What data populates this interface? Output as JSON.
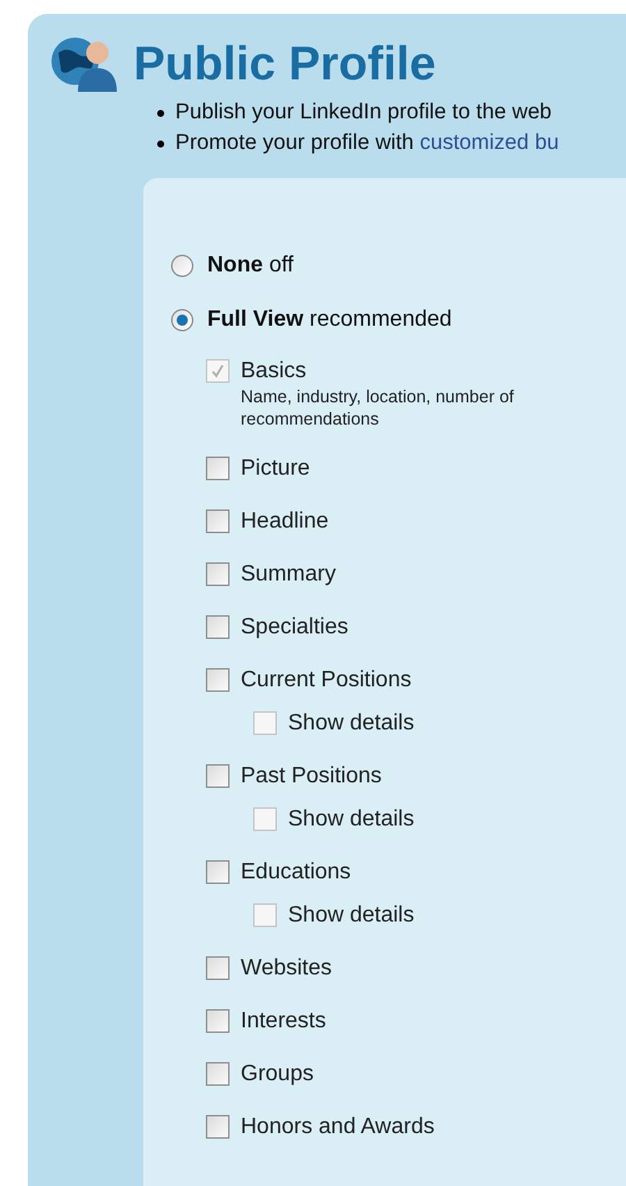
{
  "title": "Public Profile",
  "bullets": [
    {
      "text": "Publish your LinkedIn profile to the web"
    },
    {
      "text": "Promote your profile with ",
      "link": "customized bu"
    }
  ],
  "visibility": [
    {
      "label": "None",
      "note": "off",
      "selected": false
    },
    {
      "label": "Full View",
      "note": "recommended",
      "selected": true
    }
  ],
  "fields": [
    {
      "label": "Basics",
      "checked": true,
      "disabled": true,
      "description": "Name, industry, location, number of recommendations"
    },
    {
      "label": "Picture",
      "checked": false,
      "disabled": false
    },
    {
      "label": "Headline",
      "checked": false,
      "disabled": false
    },
    {
      "label": "Summary",
      "checked": false,
      "disabled": false
    },
    {
      "label": "Specialties",
      "checked": false,
      "disabled": false
    },
    {
      "label": "Current Positions",
      "checked": false,
      "disabled": false,
      "children": [
        {
          "label": "Show details",
          "checked": false,
          "disabled": true
        }
      ]
    },
    {
      "label": "Past Positions",
      "checked": false,
      "disabled": false,
      "children": [
        {
          "label": "Show details",
          "checked": false,
          "disabled": true
        }
      ]
    },
    {
      "label": "Educations",
      "checked": false,
      "disabled": false,
      "children": [
        {
          "label": "Show details",
          "checked": false,
          "disabled": true
        }
      ]
    },
    {
      "label": "Websites",
      "checked": false,
      "disabled": false
    },
    {
      "label": "Interests",
      "checked": false,
      "disabled": false
    },
    {
      "label": "Groups",
      "checked": false,
      "disabled": false
    },
    {
      "label": "Honors and Awards",
      "checked": false,
      "disabled": false
    }
  ]
}
